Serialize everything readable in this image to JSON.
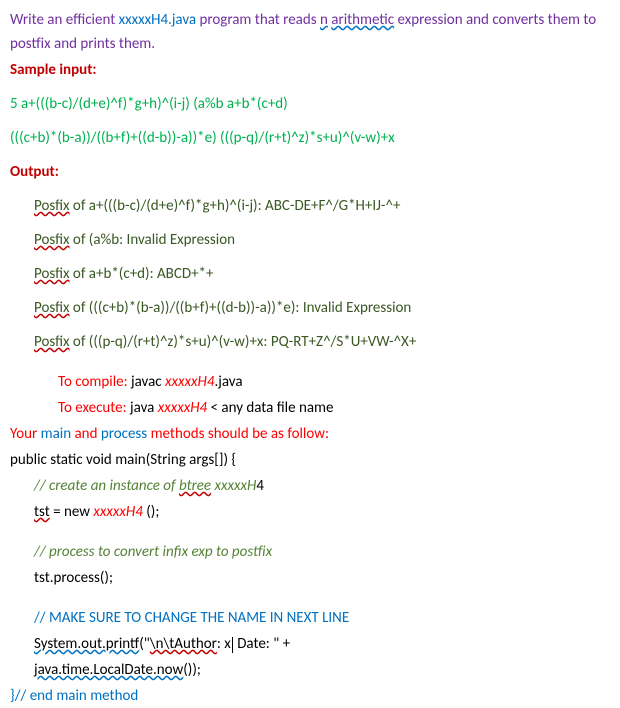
{
  "intro": {
    "w1": "Write an efficient ",
    "file": "xxxxxH4.java",
    "w2": " program that reads ",
    "n": "n",
    "w3": " ",
    "arith": "arithmetic",
    "w4": " expression and converts them to postfix and prints them."
  },
  "sample_input_label": "Sample input:",
  "sample_input_line1": "5 a+(((b-c)/(d+e)^f)*g+h)^(i-j) (a%b a+b*(c+d)",
  "sample_input_line2": "(((c+b)*(b-a))/((b+f)+((d-b))-a))*e) (((p-q)/(r+t)^z)*s+u)^(v-w)+x",
  "output_label": "Output:",
  "out1": {
    "prefix": "Posfix",
    "rest": " of a+(((b-c)/(d+e)^f)*g+h)^(i-j): ABC-DE+F^/G*H+IJ-^+"
  },
  "out2": {
    "prefix": "Posfix",
    "rest_a": " of (a%b: Invalid ",
    "rest_b": "Expression"
  },
  "out3": {
    "prefix": "Posfix",
    "rest": " of a+b*(c+d): ABCD+*+"
  },
  "out4": {
    "prefix": "Posfix",
    "rest": " of (((c+b)*(b-a))/((b+f)+((d-b))-a))*e): Invalid Expression"
  },
  "out5": {
    "prefix": "Posfix",
    "rest": " of (((p-q)/(r+t)^z)*s+u)^(v-w)+x: PQ-RT+Z^/S*U+VW-^X+"
  },
  "compile": {
    "label": "To compile:",
    "cmd_a": " javac ",
    "file": "xxxxxH4",
    "ext": ".java"
  },
  "execute": {
    "label": "To execute:",
    "cmd_a": " java ",
    "file": "xxxxxH4",
    "rest": " < any data file name"
  },
  "methods_line": {
    "p1": "Your ",
    "main": "main",
    "p2": " and ",
    "process": "process",
    "p3": " methods should be as follow:"
  },
  "code": {
    "l1": "public static void main(String args[]) {",
    "c1a": "// create an instance of ",
    "c1b": "btree",
    "c1c": " xxxxxH",
    "c1d": "4",
    "l2a": "tst",
    "l2b": " = new ",
    "l2c": "xxxxxH4",
    "l2d": " ();",
    "c2": "// process to convert infix exp to postfix",
    "l3": "tst.process();",
    "c3": "// MAKE SURE TO CHANGE THE NAME IN NEXT LINE",
    "l4a": "System.out.printf",
    "l4b": "(\"",
    "l4c": "\\n\\tAuthor",
    "l4d": ": x",
    "l4e": " Date: \" +",
    "l5a": "java.time.LocalDate.now",
    "l5b": "());",
    "l6a": "}",
    "l6b": "// end main method"
  }
}
